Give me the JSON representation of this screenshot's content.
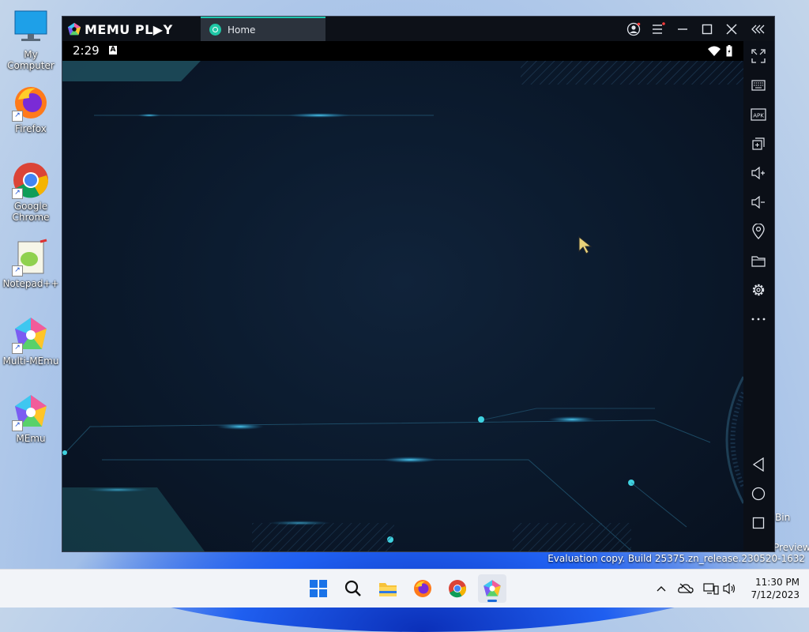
{
  "desktop": {
    "icons": [
      {
        "label": "My Computer",
        "icon": "monitor-icon"
      },
      {
        "label": "Firefox",
        "icon": "firefox-icon"
      },
      {
        "label": "Google Chrome",
        "icon": "chrome-icon"
      },
      {
        "label": "Notepad++",
        "icon": "notepadpp-icon"
      },
      {
        "label": "Multi-MEmu",
        "icon": "multi-memu-icon"
      },
      {
        "label": "MEmu",
        "icon": "memu-icon"
      }
    ],
    "recycle_label": "Bin",
    "preview_label": "Preview",
    "evaluation": "Evaluation copy. Build 25375.zn_release.230520-1632"
  },
  "memu": {
    "logo_text": "MEMU PL▶Y",
    "tab": {
      "label": "Home"
    },
    "android": {
      "time": "2:29",
      "notif_letter": "A"
    },
    "colors": {
      "accent": "#1fc7b0",
      "window_bg": "#0b0f17"
    },
    "sidebar": [
      "fullscreen-icon",
      "keyboard-icon",
      "apk-icon",
      "multi-window-icon",
      "volume-up-icon",
      "volume-down-icon",
      "location-icon",
      "folder-icon",
      "settings-icon",
      "more-icon",
      "back-icon",
      "home-icon",
      "recents-icon"
    ],
    "apk_label": "APK"
  },
  "taskbar": {
    "time": "11:30 PM",
    "date": "7/12/2023"
  }
}
